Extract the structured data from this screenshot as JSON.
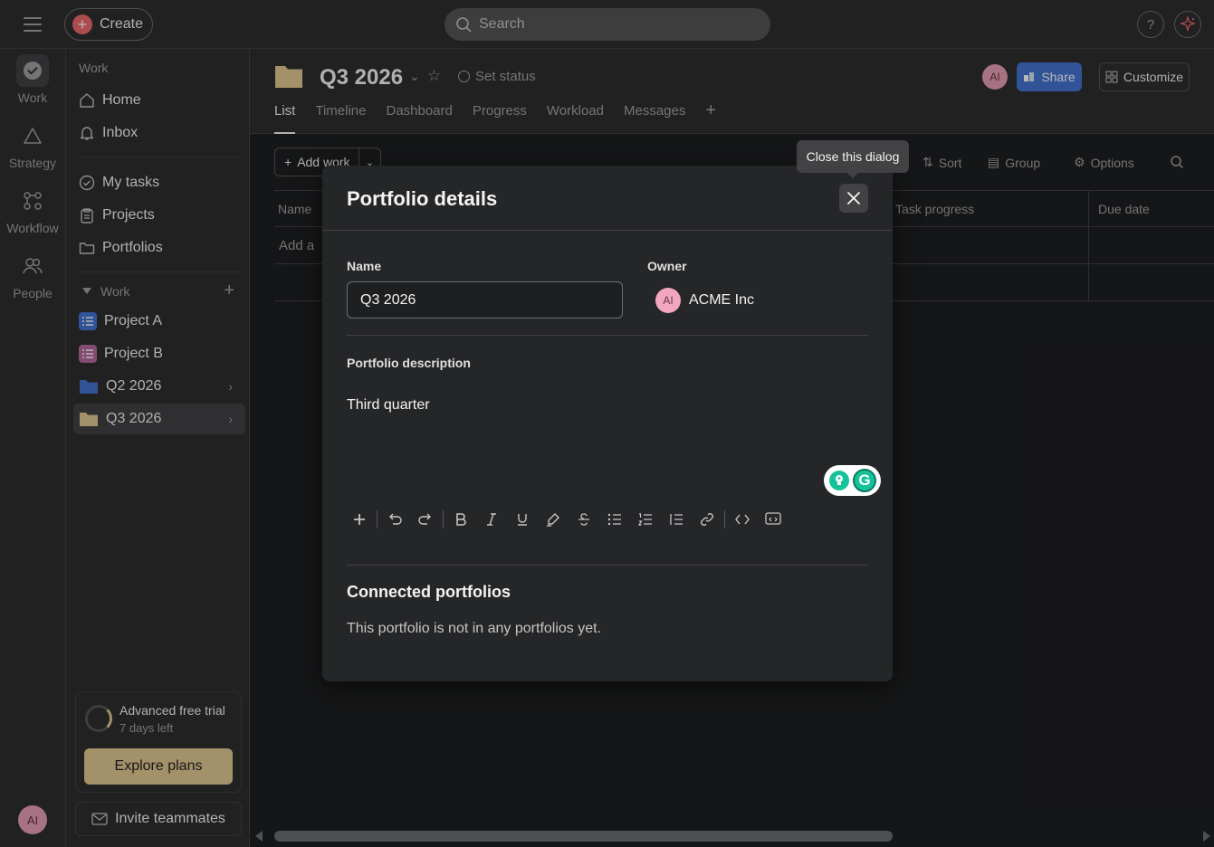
{
  "topbar": {
    "menu_icon": "hamburger-icon",
    "create_label": "Create",
    "search_placeholder": "Search",
    "help_label": "?",
    "ai_icon": "sparkle-icon"
  },
  "rail": {
    "items": [
      {
        "label": "Work",
        "icon": "check-circle-icon"
      },
      {
        "label": "Strategy",
        "icon": "triangle-icon"
      },
      {
        "label": "Workflow",
        "icon": "workflow-icon"
      },
      {
        "label": "People",
        "icon": "people-icon"
      }
    ],
    "avatar_initials": "AI"
  },
  "sidebar": {
    "heading": "Work",
    "top_items": [
      {
        "label": "Home",
        "icon": "home-icon"
      },
      {
        "label": "Inbox",
        "icon": "bell-icon"
      }
    ],
    "mid_items": [
      {
        "label": "My tasks",
        "icon": "check-circle-icon"
      },
      {
        "label": "Projects",
        "icon": "clipboard-icon"
      },
      {
        "label": "Portfolios",
        "icon": "folder-icon"
      }
    ],
    "section_label": "Work",
    "section_items": [
      {
        "label": "Project A",
        "icon": "list-icon",
        "color": "#4573d2"
      },
      {
        "label": "Project B",
        "icon": "list-icon",
        "color": "#b36bd4"
      },
      {
        "label": "Q2 2026",
        "icon": "folder-icon",
        "color": "#4573d2"
      },
      {
        "label": "Q3 2026",
        "icon": "folder-icon",
        "color": "#e2c992"
      }
    ],
    "trial": {
      "title": "Advanced free trial",
      "days": "7 days left",
      "explore_label": "Explore plans"
    },
    "invite_label": "Invite teammates"
  },
  "header": {
    "title": "Q3 2026",
    "set_status": "Set status",
    "avatar_initials": "AI",
    "share_label": "Share",
    "customize_label": "Customize",
    "tabs": [
      "List",
      "Timeline",
      "Dashboard",
      "Progress",
      "Workload",
      "Messages"
    ],
    "active_tab": "List"
  },
  "toolbar": {
    "add_work_label": "Add work",
    "sort_label": "Sort",
    "group_label": "Group",
    "options_label": "Options"
  },
  "grid": {
    "columns": [
      "Name",
      "Task progress",
      "Due date"
    ],
    "add_row_text": "Add a"
  },
  "tooltip": {
    "text": "Close this dialog"
  },
  "dialog": {
    "title": "Portfolio details",
    "name_label": "Name",
    "name_value": "Q3 2026",
    "owner_label": "Owner",
    "owner_name": "ACME Inc",
    "owner_initials": "AI",
    "description_label": "Portfolio description",
    "description_text": "Third quarter",
    "formatting_tools": [
      "plus-icon",
      "undo-icon",
      "redo-icon",
      "bold-icon",
      "italic-icon",
      "underline-icon",
      "highlight-icon",
      "strikethrough-icon",
      "bullet-list-icon",
      "numbered-list-icon",
      "indent-list-icon",
      "link-icon",
      "code-icon",
      "code-block-icon"
    ],
    "connected_title": "Connected portfolios",
    "connected_text": "This portfolio is not in any portfolios yet."
  },
  "colors": {
    "accent_create": "#f06a6a",
    "share_blue": "#4573d2",
    "trial_gold": "#e2c992",
    "avatar_pink": "#e8a0b4",
    "grammarly_green": "#15c39a"
  }
}
